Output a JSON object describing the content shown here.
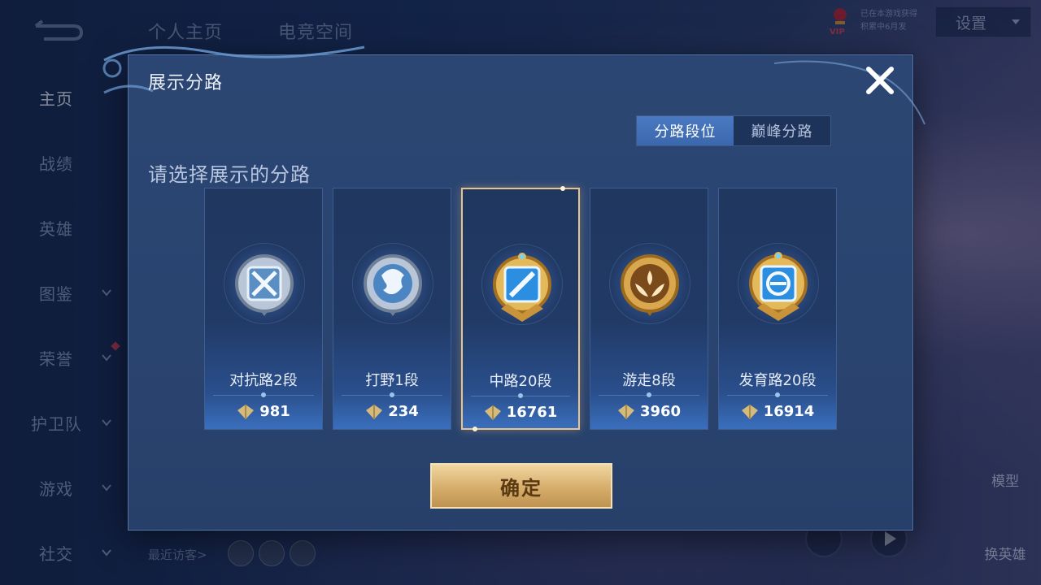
{
  "sidebar": {
    "items": [
      {
        "label": "主页",
        "active": true,
        "has_chevron": false
      },
      {
        "label": "战绩",
        "active": false,
        "has_chevron": false
      },
      {
        "label": "英雄",
        "active": false,
        "has_chevron": false
      },
      {
        "label": "图鉴",
        "active": false,
        "has_chevron": true
      },
      {
        "label": "荣誉",
        "active": false,
        "has_chevron": true,
        "has_notification": true
      },
      {
        "label": "护卫队",
        "active": false,
        "has_chevron": true
      },
      {
        "label": "游戏",
        "active": false,
        "has_chevron": true
      },
      {
        "label": "社交",
        "active": false,
        "has_chevron": true
      }
    ]
  },
  "topnav": {
    "tabs": [
      "个人主页",
      "电竞空间"
    ],
    "vip_badge": "VIP",
    "vip_line1": "已在本游戏获得",
    "vip_line2": "积累中6月发",
    "settings_label": "设置"
  },
  "bottom": {
    "recent_visitors_label": "最近访客>",
    "model_label": "模型",
    "swap_hero_label": "换英雄"
  },
  "modal": {
    "title": "展示分路",
    "tabs": [
      {
        "label": "分路段位",
        "active": true
      },
      {
        "label": "巅峰分路",
        "active": false
      }
    ],
    "prompt": "请选择展示的分路",
    "confirm_label": "确定",
    "lanes": [
      {
        "rank": "对抗路2段",
        "score": "981",
        "icon": "clash-lane-silver-badge-icon",
        "selected": false
      },
      {
        "rank": "打野1段",
        "score": "234",
        "icon": "jungle-dragon-silver-badge-icon",
        "selected": false
      },
      {
        "rank": "中路20段",
        "score": "16761",
        "icon": "mid-lane-gold-badge-icon",
        "selected": true
      },
      {
        "rank": "游走8段",
        "score": "3960",
        "icon": "roam-wings-gold-badge-icon",
        "selected": false
      },
      {
        "rank": "发育路20段",
        "score": "16914",
        "icon": "farm-lane-gold-badge-icon",
        "selected": false
      }
    ]
  },
  "colors": {
    "accent_gold": "#e7c48b",
    "tab_active": "#4a7ac2",
    "panel": "#2c4673"
  }
}
